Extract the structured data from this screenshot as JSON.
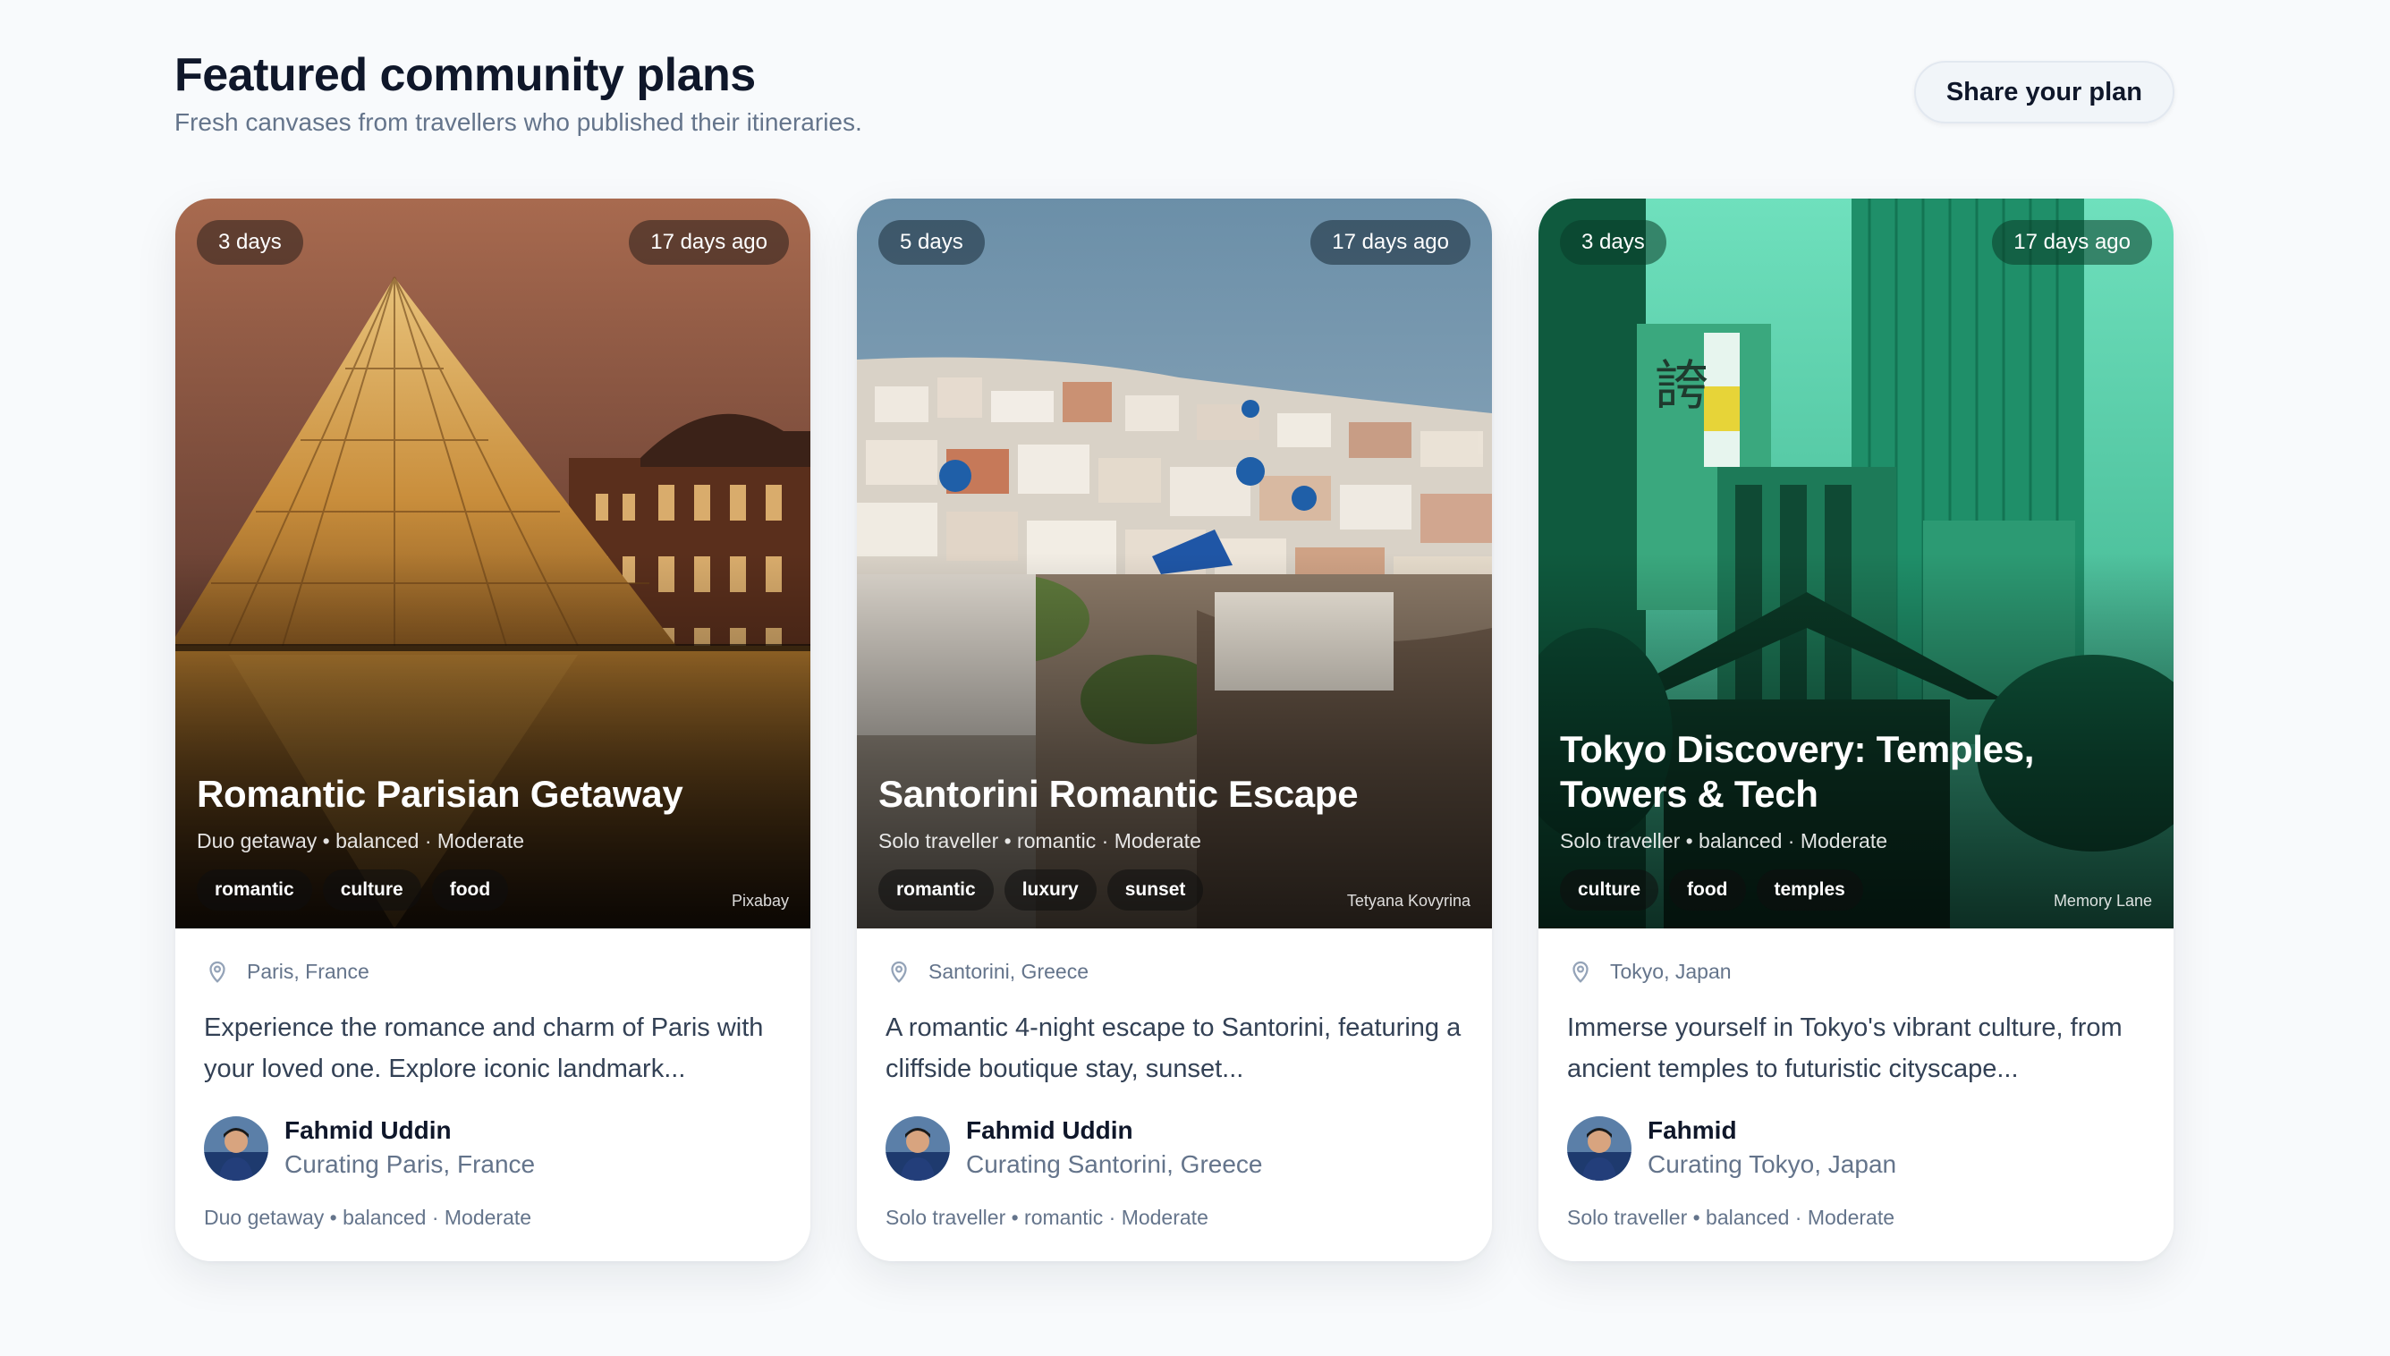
{
  "header": {
    "title": "Featured community plans",
    "subtitle": "Fresh canvases from travellers who published their itineraries.",
    "share_label": "Share your plan"
  },
  "cards": [
    {
      "duration": "3 days",
      "published": "17 days ago",
      "title": "Romantic Parisian Getaway",
      "meta": "Duo getaway • balanced · Moderate",
      "tags": [
        "romantic",
        "culture",
        "food"
      ],
      "credit": "Pixabay",
      "location": "Paris, France",
      "description": "Experience the romance and charm of Paris with your loved one. Explore iconic landmark...",
      "author_name": "Fahmid Uddin",
      "author_sub": "Curating Paris, France",
      "footer": "Duo getaway • balanced · Moderate"
    },
    {
      "duration": "5 days",
      "published": "17 days ago",
      "title": "Santorini Romantic Escape",
      "meta": "Solo traveller • romantic · Moderate",
      "tags": [
        "romantic",
        "luxury",
        "sunset"
      ],
      "credit": "Tetyana Kovyrina",
      "location": "Santorini, Greece",
      "description": "A romantic 4-night escape to Santorini, featuring a cliffside boutique stay, sunset...",
      "author_name": "Fahmid Uddin",
      "author_sub": "Curating Santorini, Greece",
      "footer": "Solo traveller • romantic · Moderate"
    },
    {
      "duration": "3 days",
      "published": "17 days ago",
      "title": "Tokyo Discovery: Temples, Towers & Tech",
      "meta": "Solo traveller • balanced · Moderate",
      "tags": [
        "culture",
        "food",
        "temples"
      ],
      "credit": "Memory Lane",
      "location": "Tokyo, Japan",
      "description": "Immerse yourself in Tokyo's vibrant culture, from ancient temples to futuristic cityscape...",
      "author_name": "Fahmid",
      "author_sub": "Curating Tokyo, Japan",
      "footer": "Solo traveller • balanced · Moderate"
    }
  ]
}
